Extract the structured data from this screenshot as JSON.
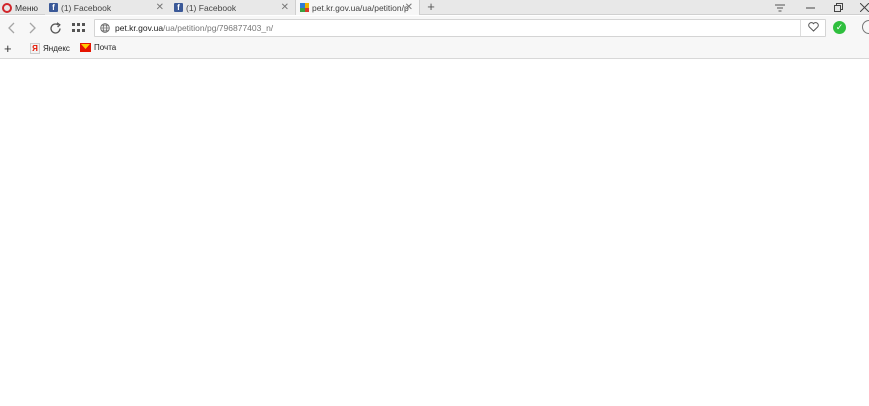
{
  "tabbar": {
    "menu_label": "Меню",
    "tabs": [
      {
        "title": "(1) Facebook",
        "favicon": "facebook-icon",
        "active": false
      },
      {
        "title": "(1) Facebook",
        "favicon": "facebook-icon",
        "active": false
      },
      {
        "title": "pet.kr.gov.ua/ua/petition/p",
        "favicon": "kr-gov-icon",
        "active": true
      }
    ],
    "new_tab_symbol": "+"
  },
  "toolbar": {
    "url_host": "pet.kr.gov.ua",
    "url_path": "/ua/petition/pg/796877403_n/"
  },
  "bookmarks": {
    "items": [
      {
        "label": "Яндекс",
        "icon": "yandex-icon"
      },
      {
        "label": "Почта",
        "icon": "mail-icon"
      }
    ]
  },
  "colors": {
    "opera_red": "#d1252a",
    "facebook_blue": "#3b5998",
    "ext_green": "#2fbf3e"
  }
}
